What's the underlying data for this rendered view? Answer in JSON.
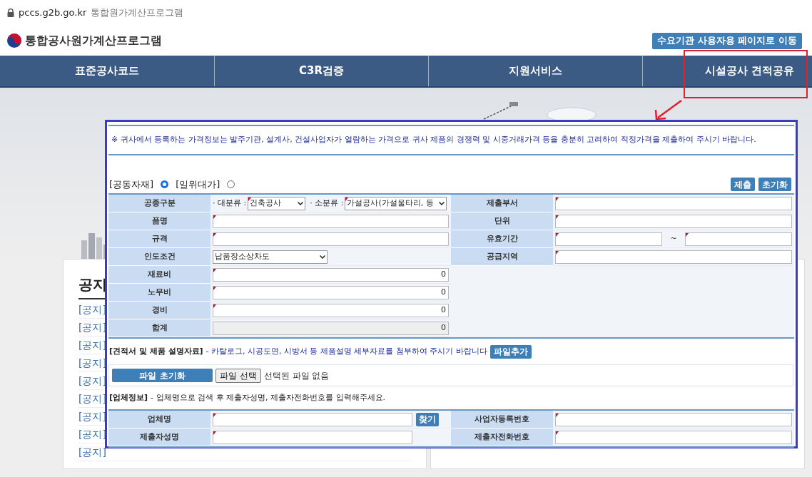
{
  "browser": {
    "url": "pccs.g2b.go.kr",
    "title": "통합원가계산프로그램"
  },
  "header": {
    "site_title": "통합공사원가계산프로그램",
    "user_page_button": "수요기관 사용자용 페이지로 이동"
  },
  "nav": [
    {
      "label": "표준공사코드",
      "annotated": false
    },
    {
      "label": "C3R검증",
      "annotated": false
    },
    {
      "label": "지원서비스",
      "annotated": false
    },
    {
      "label": "시설공사 견적공유",
      "annotated": true
    }
  ],
  "background": {
    "notice_heading": "공지",
    "notice_items": [
      "[공지]",
      "[공지]",
      "[공지]",
      "[공지]",
      "[공지]",
      "[공지]",
      "[공지]",
      "[공지]",
      "[공지]"
    ]
  },
  "modal": {
    "notice": "※ 귀사에서 등록하는 가격정보는 발주기관, 설계사, 건설사업자가 열람하는 가격으로 귀사 제품의 경쟁력 및 시중거래가격 등을 충분히 고려하여 적정가격을 제출하여 주시기 바랍니다.",
    "type_options": [
      {
        "label": "[공동자재]",
        "selected": true
      },
      {
        "label": "[일위대가]",
        "selected": false
      }
    ],
    "buttons": [
      "제출",
      "초기화"
    ],
    "product_rows": [
      {
        "left": {
          "label": "공종구분",
          "fields": [
            {
              "kind": "labeled-select",
              "label": "· 대분류 :",
              "value": "건축공사",
              "required": true
            },
            {
              "kind": "labeled-select",
              "label": "· 소분류 :",
              "value": "가설공사(가설울타리, 동",
              "required": true
            }
          ]
        },
        "right": {
          "label": "제출부서",
          "fields": [
            {
              "kind": "text",
              "required": true
            }
          ]
        }
      },
      {
        "left": {
          "label": "품명",
          "fields": [
            {
              "kind": "text",
              "required": true
            }
          ]
        },
        "right": {
          "label": "단위",
          "fields": [
            {
              "kind": "text",
              "required": true
            }
          ]
        }
      },
      {
        "left": {
          "label": "규격",
          "fields": [
            {
              "kind": "text",
              "required": true
            }
          ]
        },
        "right": {
          "label": "유효기간",
          "fields": [
            {
              "kind": "text",
              "required": true
            },
            {
              "kind": "separator",
              "text": "~"
            },
            {
              "kind": "text",
              "required": true
            }
          ]
        }
      },
      {
        "left": {
          "label": "인도조건",
          "fields": [
            {
              "kind": "select",
              "value": "납품장소상차도",
              "required": false
            }
          ]
        },
        "right": {
          "label": "공급지역",
          "fields": [
            {
              "kind": "text",
              "required": true
            }
          ]
        }
      },
      {
        "left": {
          "label": "재료비",
          "fields": [
            {
              "kind": "number",
              "value": "0",
              "required": true
            }
          ]
        }
      },
      {
        "left": {
          "label": "노무비",
          "fields": [
            {
              "kind": "number",
              "value": "0",
              "required": true
            }
          ]
        }
      },
      {
        "left": {
          "label": "경비",
          "fields": [
            {
              "kind": "number",
              "value": "0",
              "required": true
            }
          ]
        }
      },
      {
        "left": {
          "label": "합계",
          "fields": [
            {
              "kind": "readonly",
              "value": "0",
              "required": false
            }
          ]
        }
      }
    ],
    "attachments": {
      "heading": "[견적서 및 제품 설명자료]",
      "description": "- 카탈로그, 시공도면, 시방서 등 제품설명 세부자료를 첨부하여 주시기 바랍니다",
      "add_button": "파일추가",
      "reset_button": "파일 초기화",
      "choose_button": "파일 선택",
      "file_status": "선택된 파일 없음"
    },
    "company": {
      "heading": "[업체정보]",
      "description": "- 업체명으로 검색 후 제출자성명, 제출자전화번호를 입력해주세요.",
      "rows": [
        {
          "left": {
            "label": "업체명",
            "fields": [
              {
                "kind": "text",
                "required": true
              },
              {
                "kind": "button",
                "text": "찾기"
              }
            ]
          },
          "right": {
            "label": "사업자등록번호",
            "fields": [
              {
                "kind": "text",
                "required": true
              }
            ]
          }
        },
        {
          "left": {
            "label": "제출자성명",
            "fields": [
              {
                "kind": "text",
                "required": true
              }
            ]
          },
          "right": {
            "label": "제출자전화번호",
            "fields": [
              {
                "kind": "text",
                "required": true
              }
            ]
          }
        }
      ]
    }
  }
}
